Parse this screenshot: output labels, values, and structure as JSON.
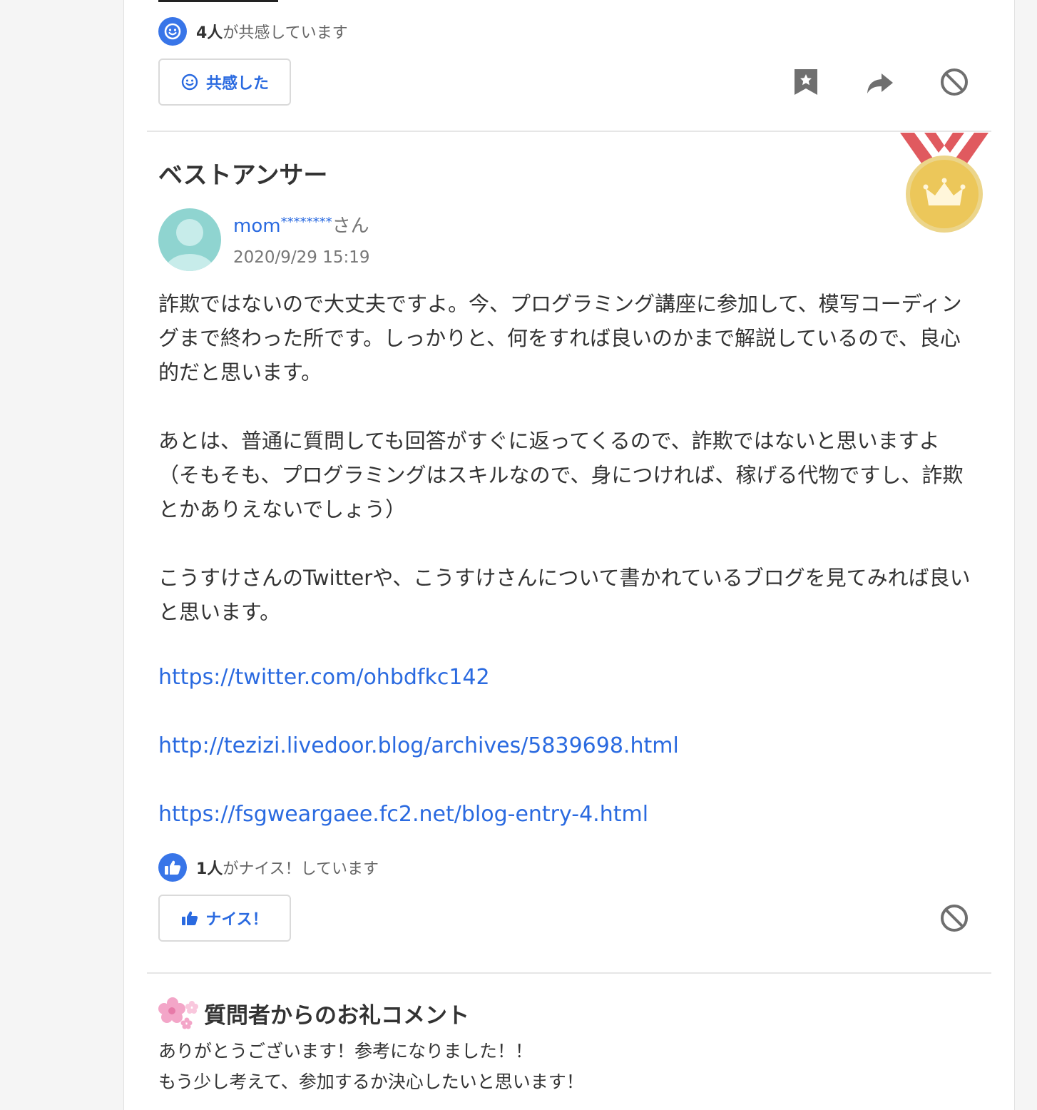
{
  "question_footer": {
    "empathy_count": "4人",
    "empathy_suffix": "が共感しています",
    "empathy_button_label": "共感した",
    "icons": [
      "smile-icon",
      "bookmark-star-icon",
      "share-arrow-icon",
      "block-icon"
    ]
  },
  "best_answer": {
    "section_title": "ベストアンサー",
    "user_name": "mom",
    "user_mask": "********",
    "user_suffix": "さん",
    "date": "2020/9/29 15:19",
    "paragraphs": [
      "詐欺ではないので大丈夫ですよ。今、プログラミング講座に参加して、模写コーディングまで終わった所です。しっかりと、何をすれば良いのかまで解説しているので、良心的だと思います。",
      "あとは、普通に質問しても回答がすぐに返ってくるので、詐欺ではないと思いますよ（そもそも、プログラミングはスキルなので、身につければ、稼げる代物ですし、詐欺とかありえないでしょう）",
      "こうすけさんのTwitterや、こうすけさんについて書かれているブログを見てみれば良いと思います。"
    ],
    "links": [
      "https://twitter.com/ohbdfkc142",
      "http://tezizi.livedoor.blog/archives/5839698.html",
      "https://fsgweargaee.fc2.net/blog-entry-4.html"
    ],
    "nice_count": "1人",
    "nice_suffix": "がナイス！しています",
    "nice_button_label": "ナイス！",
    "colors": {
      "link": "#2a6ae0",
      "medal": "#ecc75a",
      "ribbon": "#e05a5f"
    }
  },
  "thanks": {
    "title": "質問者からのお礼コメント",
    "line1": "ありがとうございます！参考になりました！！",
    "line2": "もう少し考えて、参加するか決心したいと思います！"
  }
}
